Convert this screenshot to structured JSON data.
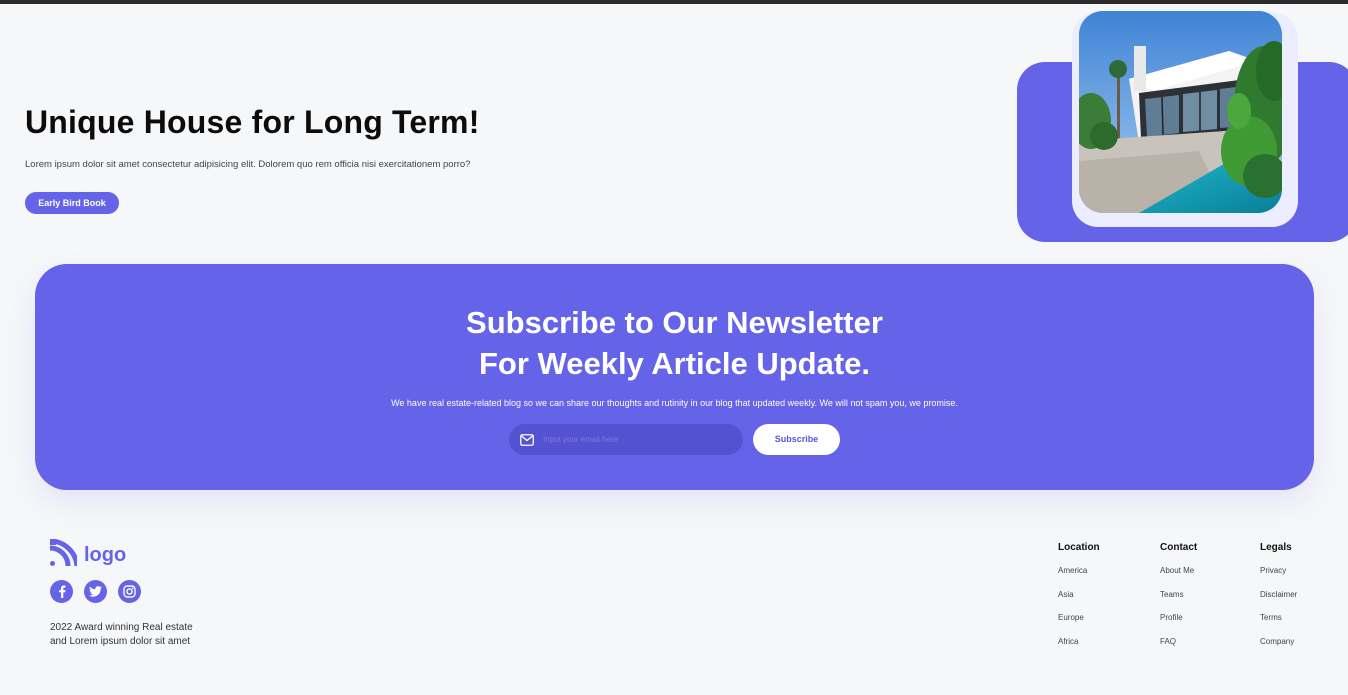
{
  "hero": {
    "title": "Unique House for Long Term!",
    "description": "Lorem ipsum dolor sit amet consectetur adipisicing elit. Dolorem quo rem officia nisi exercitationem porro?",
    "cta_label": "Early Bird Book"
  },
  "newsletter": {
    "title_line1": "Subscribe to Our Newsletter",
    "title_line2": "For Weekly Article Update.",
    "description": "We have real estate-related blog so we can share our thoughts and rutinity in our blog that updated weekly. We will not spam you, we promise.",
    "input_placeholder": "Input your email here",
    "subscribe_label": "Subscribe"
  },
  "footer": {
    "logo_text": "logo",
    "social_icons": [
      "facebook-icon",
      "twitter-icon",
      "instagram-icon"
    ],
    "tagline_line1": "2022 Award winning Real estate",
    "tagline_line2": "and Lorem ipsum dolor sit amet",
    "columns": [
      {
        "heading": "Location",
        "links": [
          "America",
          "Asia",
          "Europe",
          "Africa"
        ]
      },
      {
        "heading": "Contact",
        "links": [
          "About Me",
          "Teams",
          "Profile",
          "FAQ"
        ]
      },
      {
        "heading": "Legals",
        "links": [
          "Privacy",
          "Disclaimer",
          "Terms",
          "Company"
        ]
      }
    ]
  },
  "colors": {
    "accent": "#6563e8",
    "background": "#f6f7f9",
    "text": "#0c0c0c"
  }
}
